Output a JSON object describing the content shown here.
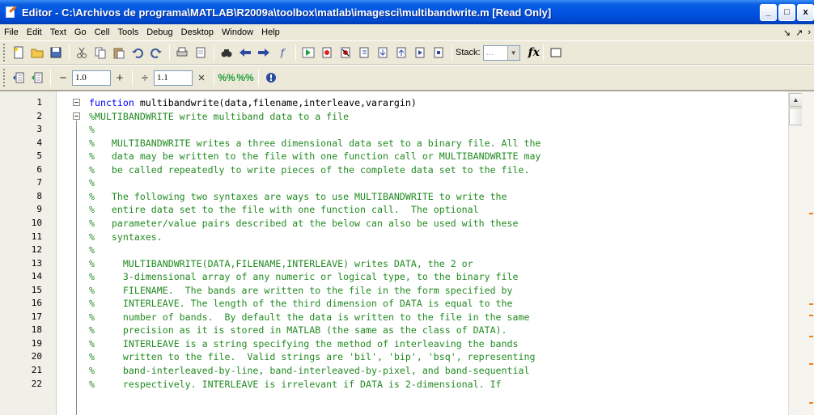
{
  "window": {
    "title": "Editor - C:\\Archivos de programa\\MATLAB\\R2009a\\toolbox\\matlab\\imagesci\\multibandwrite.m [Read Only]",
    "minimize_glyph": "_",
    "restore_glyph": "□",
    "close_glyph": "x"
  },
  "menu": {
    "items": [
      "File",
      "Edit",
      "Text",
      "Go",
      "Cell",
      "Tools",
      "Debug",
      "Desktop",
      "Window",
      "Help"
    ],
    "right_glyphs": [
      "↘",
      "↗",
      "›"
    ]
  },
  "toolbar1": {
    "icons": [
      "new-file-icon",
      "open-folder-icon",
      "save-icon",
      "cut-icon",
      "copy-icon",
      "paste-icon",
      "undo-icon",
      "redo-icon",
      "print-icon",
      "page-setup-icon",
      "find-icon",
      "back-arrow-icon",
      "forward-arrow-icon",
      "function-call-icon",
      "run-icon",
      "breakpoint-icon",
      "clear-breakpoint-icon",
      "step-icon",
      "step-in-icon",
      "step-out-icon",
      "continue-icon",
      "exit-debug-icon"
    ],
    "stack_label": "Stack:",
    "stack_value": "...",
    "fx_label": "fx"
  },
  "toolbar2": {
    "minus_label": "−",
    "value1": "1.0",
    "plus_label": "+",
    "divide_label": "÷",
    "value2": "1.1",
    "times_label": "×"
  },
  "editor": {
    "line_numbers": [
      "1",
      "2",
      "3",
      "4",
      "5",
      "6",
      "7",
      "8",
      "9",
      "10",
      "11",
      "12",
      "13",
      "14",
      "15",
      "16",
      "17",
      "18",
      "19",
      "20",
      "21",
      "22"
    ],
    "lines": [
      {
        "kw": "function",
        "text": " multibandwrite(data,filename,interleave,varargin)"
      },
      {
        "kw": "",
        "text": "%MULTIBANDWRITE write multiband data to a file"
      },
      {
        "kw": "",
        "text": "%"
      },
      {
        "kw": "",
        "text": "%   MULTIBANDWRITE writes a three dimensional data set to a binary file. All the"
      },
      {
        "kw": "",
        "text": "%   data may be written to the file with one function call or MULTIBANDWRITE may"
      },
      {
        "kw": "",
        "text": "%   be called repeatedly to write pieces of the complete data set to the file."
      },
      {
        "kw": "",
        "text": "%"
      },
      {
        "kw": "",
        "text": "%   The following two syntaxes are ways to use MULTIBANDWRITE to write the"
      },
      {
        "kw": "",
        "text": "%   entire data set to the file with one function call.  The optional"
      },
      {
        "kw": "",
        "text": "%   parameter/value pairs described at the below can also be used with these"
      },
      {
        "kw": "",
        "text": "%   syntaxes."
      },
      {
        "kw": "",
        "text": "%"
      },
      {
        "kw": "",
        "text": "%     MULTIBANDWRITE(DATA,FILENAME,INTERLEAVE) writes DATA, the 2 or"
      },
      {
        "kw": "",
        "text": "%     3-dimensional array of any numeric or logical type, to the binary file"
      },
      {
        "kw": "",
        "text": "%     FILENAME.  The bands are written to the file in the form specified by"
      },
      {
        "kw": "",
        "text": "%     INTERLEAVE. The length of the third dimension of DATA is equal to the"
      },
      {
        "kw": "",
        "text": "%     number of bands.  By default the data is written to the file in the same"
      },
      {
        "kw": "",
        "text": "%     precision as it is stored in MATLAB (the same as the class of DATA)."
      },
      {
        "kw": "",
        "text": "%     INTERLEAVE is a string specifying the method of interleaving the bands"
      },
      {
        "kw": "",
        "text": "%     written to the file.  Valid strings are 'bil', 'bip', 'bsq', representing"
      },
      {
        "kw": "",
        "text": "%     band-interleaved-by-line, band-interleaved-by-pixel, and band-sequential"
      },
      {
        "kw": "",
        "text": "%     respectively. INTERLEAVE is irrelevant if DATA is 2-dimensional. If"
      }
    ]
  },
  "scrollbar": {
    "up_glyph": "▲"
  }
}
